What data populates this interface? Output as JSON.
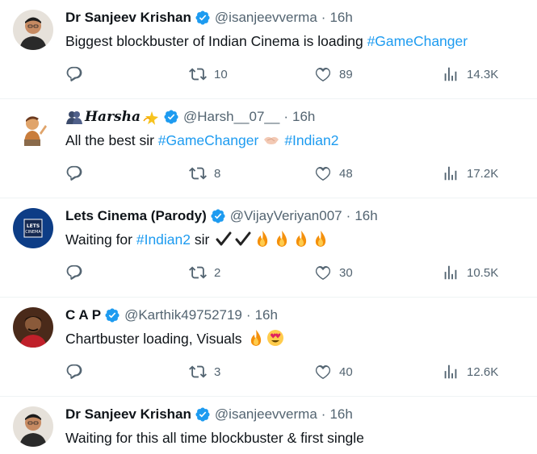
{
  "tweets": [
    {
      "name": "Dr Sanjeev Krishan",
      "handle": "@isanjeevverma",
      "time": "16h",
      "text_parts": [
        "Biggest blockbuster of Indian Cinema is loading ",
        "#GameChanger"
      ],
      "replies": "",
      "retweets": "10",
      "likes": "89",
      "views": "14.3K"
    },
    {
      "name": "Harsha",
      "handle": "@Harsh__07__",
      "time": "16h",
      "text_parts": [
        "All the best sir ",
        "#GameChanger",
        "#Indian2"
      ],
      "replies": "",
      "retweets": "8",
      "likes": "48",
      "views": "17.2K"
    },
    {
      "name": "Lets Cinema (Parody)",
      "handle": "@VijayVeriyan007",
      "time": "16h",
      "text_parts": [
        "Waiting for ",
        "#Indian2",
        " sir "
      ],
      "replies": "",
      "retweets": "2",
      "likes": "30",
      "views": "10.5K"
    },
    {
      "name": "C A P",
      "handle": "@Karthik49752719",
      "time": "16h",
      "text_parts": [
        "Chartbuster loading, Visuals "
      ],
      "replies": "",
      "retweets": "3",
      "likes": "40",
      "views": "12.6K"
    },
    {
      "name": "Dr Sanjeev Krishan",
      "handle": "@isanjeevverma",
      "time": "16h",
      "text_parts": [
        "Waiting for this all time blockbuster & first single"
      ]
    }
  ],
  "dot": "·",
  "colors": {
    "verified": "#1d9bf0",
    "hashtag": "#1d9bf0",
    "muted": "#536471"
  },
  "icons": [
    "reply-icon",
    "retweet-icon",
    "like-icon",
    "views-icon",
    "verified-badge-icon",
    "fire-emoji",
    "heart-eyes-emoji",
    "handshake-emoji",
    "check-emoji"
  ]
}
